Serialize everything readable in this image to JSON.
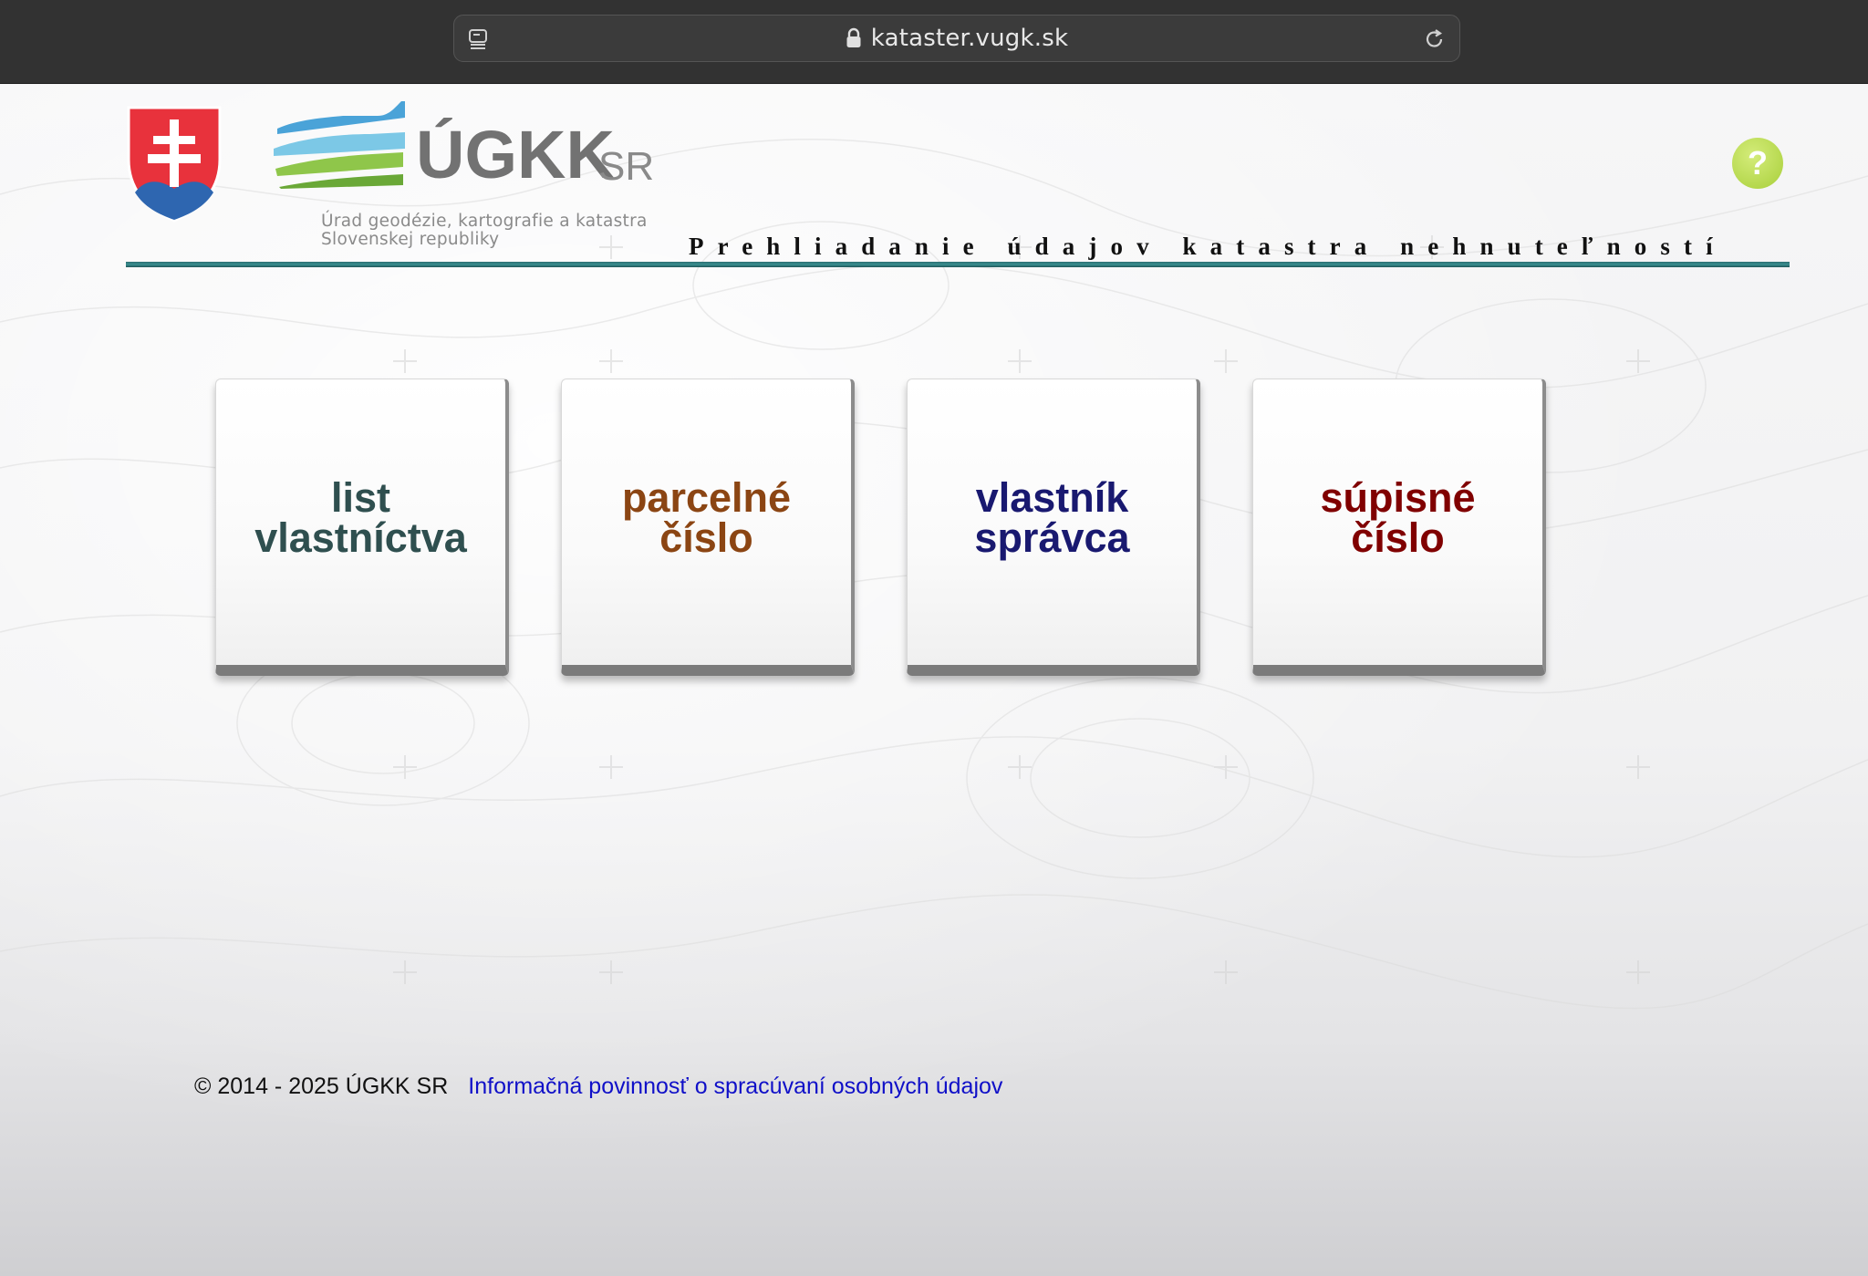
{
  "browser": {
    "url": "kataster.vugk.sk"
  },
  "header": {
    "logo_text": "ÚGKK",
    "logo_suffix": "SR",
    "logo_subtitle_line1": "Úrad geodézie, kartografie a katastra",
    "logo_subtitle_line2": "Slovenskej republiky",
    "tagline": "Prehliadanie údajov katastra nehnuteľností",
    "help_label": "?"
  },
  "tiles": [
    {
      "label": "list\nvlastníctva",
      "color": "#2f4f4f"
    },
    {
      "label": "parcelné\nčíslo",
      "color": "#8b4513"
    },
    {
      "label": "vlastník\nsprávca",
      "color": "#191970"
    },
    {
      "label": "súpisné\nčíslo",
      "color": "#800000"
    }
  ],
  "footer": {
    "copyright": "© 2014 - 2025 ÚGKK SR",
    "privacy_link": "Informačná povinnosť o spracúvaní osobných údajov"
  },
  "colors": {
    "accent_rule": "#2b6f72",
    "help": "#a8cf3a",
    "link": "#1010c8"
  }
}
